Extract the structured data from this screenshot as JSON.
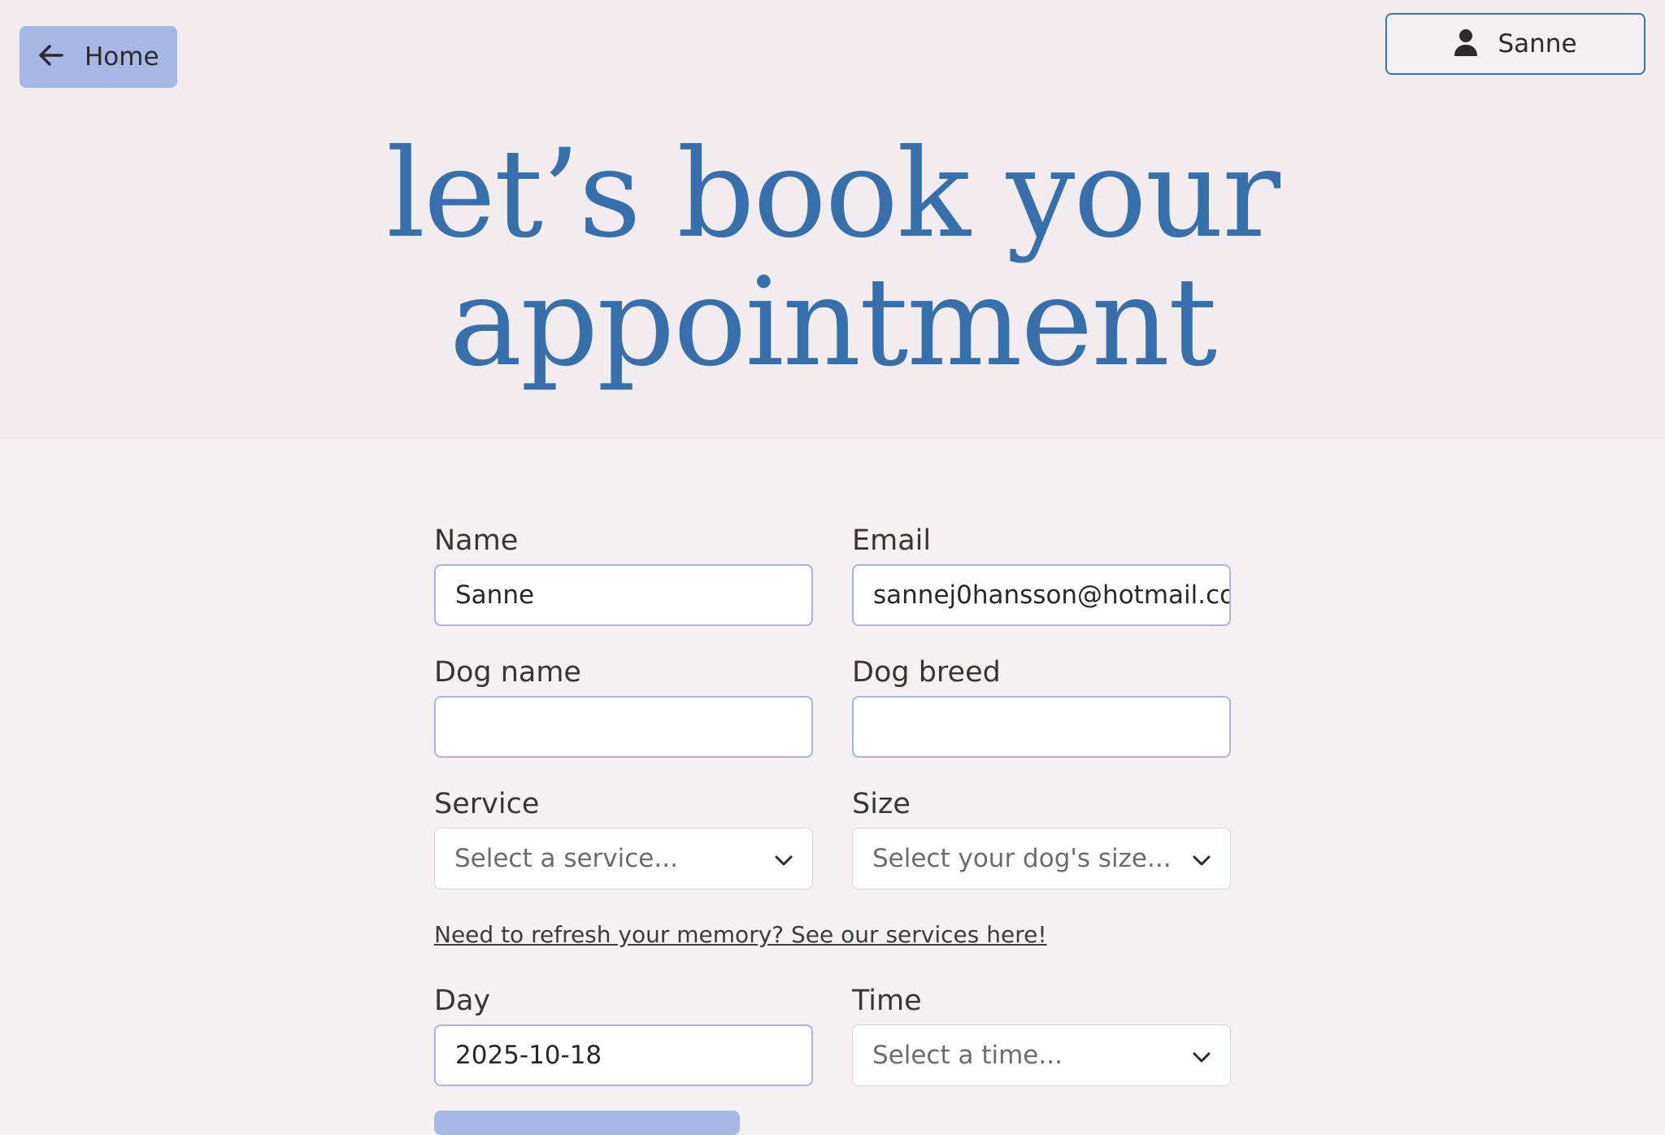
{
  "nav": {
    "home_label": "Home",
    "user_label": "Sanne"
  },
  "hero": {
    "title_line1": "let’s book your",
    "title_line2": "appointment"
  },
  "form": {
    "name": {
      "label": "Name",
      "value": "Sanne"
    },
    "email": {
      "label": "Email",
      "value": "sannej0hansson@hotmail.co"
    },
    "dog_name": {
      "label": "Dog name",
      "value": ""
    },
    "dog_breed": {
      "label": "Dog breed",
      "value": ""
    },
    "service": {
      "label": "Service",
      "placeholder": "Select a service..."
    },
    "size": {
      "label": "Size",
      "placeholder": "Select your dog's size..."
    },
    "services_link": "Need to refresh your memory? See our services here!",
    "day": {
      "label": "Day",
      "value": "2025-10-18"
    },
    "time": {
      "label": "Time",
      "placeholder": "Select a time..."
    }
  },
  "colors": {
    "accent": "#3570ad",
    "button": "#a7b8e6",
    "input_border": "#a9b4df",
    "hero_bg": "#f2ecef",
    "page_bg": "#f5f0f2"
  }
}
